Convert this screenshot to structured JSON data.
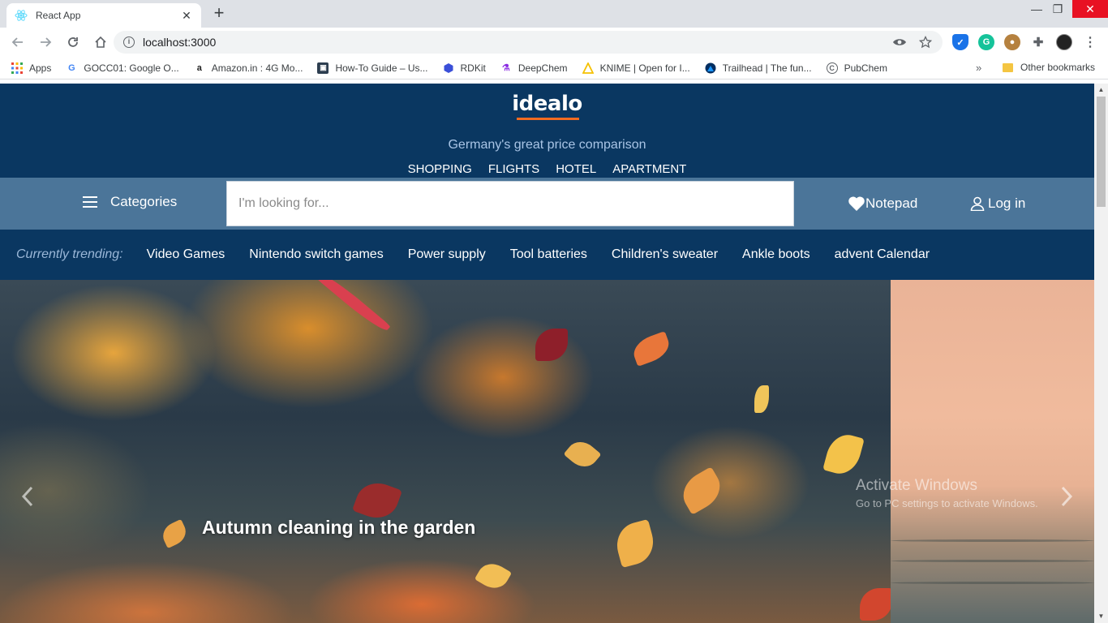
{
  "browser": {
    "tab_title": "React App",
    "tab_close": "✕",
    "new_tab": "+",
    "window_controls": {
      "minimize": "—",
      "restore": "❐",
      "close": "✕"
    },
    "url": "localhost:3000",
    "bookmarks": [
      {
        "label": "Apps",
        "icon": "apps-grid-icon"
      },
      {
        "label": "GOCC01: Google O...",
        "icon": "google-icon"
      },
      {
        "label": "Amazon.in : 4G Mo...",
        "icon": "amazon-icon"
      },
      {
        "label": "How-To Guide – Us...",
        "icon": "guide-icon"
      },
      {
        "label": "RDKit",
        "icon": "rdkit-icon"
      },
      {
        "label": "DeepChem",
        "icon": "deepchem-icon"
      },
      {
        "label": "KNIME | Open for I...",
        "icon": "knime-icon"
      },
      {
        "label": "Trailhead | The fun...",
        "icon": "trailhead-icon"
      },
      {
        "label": "PubChem",
        "icon": "pubchem-icon"
      }
    ],
    "bookmarks_more": "»",
    "other_bookmarks": "Other bookmarks"
  },
  "site": {
    "logo": "idealo",
    "tagline": "Germany's great price comparison",
    "nav": [
      "SHOPPING",
      "FLIGHTS",
      "HOTEL",
      "APARTMENT"
    ],
    "categories_label": "Categories",
    "search_placeholder": "I'm looking for...",
    "notepad_label": "Notepad",
    "login_label": "Log in",
    "trending_label": "Currently trending:",
    "trending": [
      "Video Games",
      "Nintendo switch games",
      "Power supply",
      "Tool batteries",
      "Children's sweater",
      "Ankle boots",
      "advent Calendar"
    ],
    "slide_caption": "Autumn cleaning in the garden"
  },
  "os_watermark": {
    "line1": "Activate Windows",
    "line2": "Go to PC settings to activate Windows."
  },
  "colors": {
    "header_bg": "#0a3761",
    "searchbar_bg": "#4b7599",
    "logo_underline": "#f26b21",
    "tagline": "#a9c5e6"
  }
}
